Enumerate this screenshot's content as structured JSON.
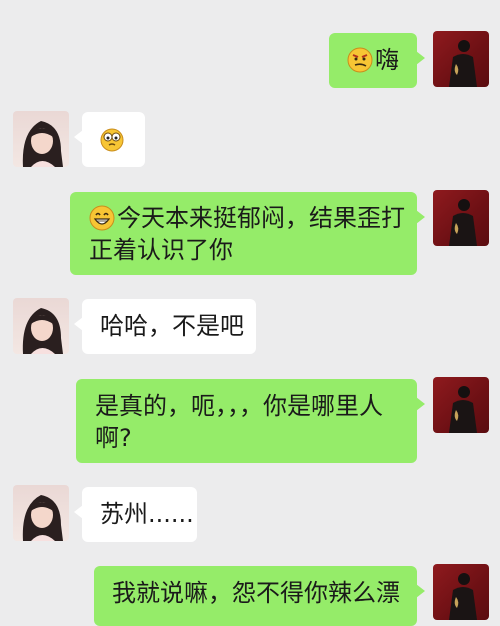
{
  "conversation": {
    "messages": [
      {
        "from": "me",
        "emoji": "smirk-emoji",
        "text": "嗨"
      },
      {
        "from": "her",
        "emoji": "goggle-eyes-emoji",
        "text": ""
      },
      {
        "from": "me",
        "emoji": "grin-emoji",
        "line1": "今天本来挺郁闷，结果歪打",
        "line2": "正着认识了你"
      },
      {
        "from": "her",
        "text": "哈哈，不是吧"
      },
      {
        "from": "me",
        "line1": "是真的，呃，，，你是哪里人",
        "line2": "啊?"
      },
      {
        "from": "her",
        "text": "苏州......"
      },
      {
        "from": "me",
        "text": "我就说嘛，怨不得你辣么漂"
      }
    ]
  },
  "colors": {
    "background": "#ececed",
    "my_bubble": "#95ec69",
    "her_bubble": "#ffffff"
  }
}
